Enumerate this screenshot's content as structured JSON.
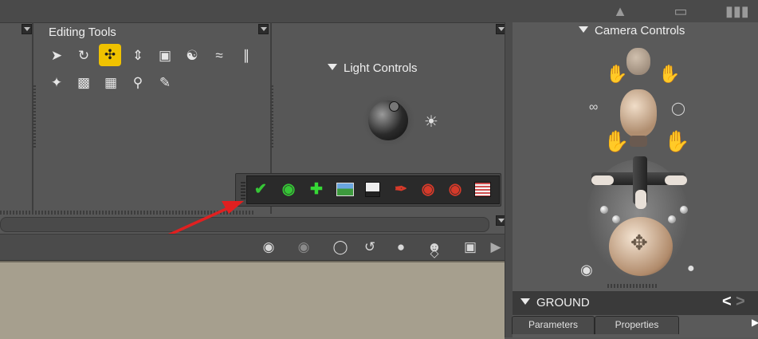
{
  "editing_tools": {
    "title": "Editing Tools",
    "row1": [
      "select-arrow",
      "rotate-arrows",
      "translate-move",
      "up-down-arrow",
      "scale-box",
      "twist",
      "taper",
      "chain"
    ],
    "row2": [
      "morph-brush",
      "paint-bucket",
      "direct-manipulation",
      "zoom",
      "grouping"
    ]
  },
  "light_controls": {
    "title": "Light Controls"
  },
  "camera_controls": {
    "title": "Camera Controls"
  },
  "quick_toolbar": {
    "icons": [
      "checkmark",
      "eye",
      "plus",
      "landscape",
      "floppy-save",
      "red-tool-1",
      "palette-1",
      "palette-2",
      "render-window"
    ]
  },
  "view_bar": {
    "icons": [
      "camera",
      "camera-disabled",
      "camera-frame",
      "orbit",
      "trackball",
      "crowd",
      "move-xz",
      "film-camera",
      "arrow-right"
    ]
  },
  "ground_panel": {
    "title": "GROUND",
    "tabs": [
      "Parameters",
      "Properties"
    ],
    "prev": "<",
    "next": ">"
  },
  "annotation": {
    "arrow_color": "#e02020"
  },
  "colors": {
    "active_tool": "#f0c200",
    "canvas": "#a69f8e"
  }
}
